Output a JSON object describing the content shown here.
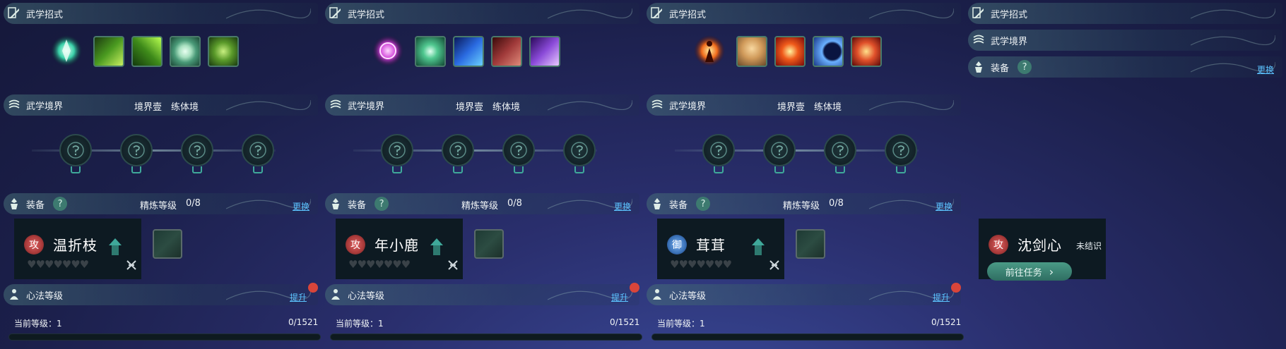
{
  "section_titles": {
    "skills": "武学招式",
    "realm": "武学境界",
    "equip": "装备",
    "xinfa": "心法等级"
  },
  "help_symbol": "?",
  "panels": [
    {
      "skills": [
        "green-aura-icon",
        "leaf-slash-icon",
        "green-claw-icon",
        "jade-ring-icon",
        "taiji-icon"
      ],
      "realm_stage": "境界壹　练体境",
      "refine_level": "精炼等级",
      "refine_value": "0/8",
      "change_label": "更换",
      "character": {
        "type_badge": "攻",
        "name": "温折枝",
        "hearts": "♥♥♥♥♥♥♥"
      },
      "upgrade_label": "提升",
      "current_level": "当前等级：1",
      "exp": "0/1521",
      "progress_fraction": 0
    },
    {
      "skills": [
        "purple-sigil-icon",
        "green-burst-icon",
        "blue-wave-icon",
        "red-beast-icon",
        "purple-spirit-icon"
      ],
      "realm_stage": "境界壹　练体境",
      "refine_level": "精炼等级",
      "refine_value": "0/8",
      "change_label": "更换",
      "character": {
        "type_badge": "攻",
        "name": "年小鹿",
        "hearts": "♥♥♥♥♥♥♥"
      },
      "upgrade_label": "提升",
      "current_level": "当前等级：1",
      "exp": "0/1521",
      "progress_fraction": 0
    },
    {
      "skills": [
        "fire-figure-icon",
        "buddha-face-icon",
        "fire-blast-icon",
        "crescent-moon-icon",
        "flame-vortex-icon"
      ],
      "realm_stage": "境界壹　练体境",
      "refine_level": "精炼等级",
      "refine_value": "0/8",
      "change_label": "更换",
      "character": {
        "type_badge": "御",
        "name": "茸茸",
        "hearts": "♥♥♥♥♥♥♥"
      },
      "upgrade_label": "提升",
      "current_level": "当前等级：1",
      "exp": "0/1521",
      "progress_fraction": 0
    }
  ],
  "panel4": {
    "change_label": "更换",
    "character": {
      "type_badge": "攻",
      "name": "沈剑心",
      "status": "未结识"
    },
    "goto_task": "前往任务",
    "goto_arrow": "›"
  },
  "colors": {
    "accent_teal": "#3fa89a",
    "link_blue": "#5cc4ff",
    "red_dot": "#d9453a",
    "attack_badge": "#a83a3a",
    "defense_badge": "#3a72b8"
  }
}
